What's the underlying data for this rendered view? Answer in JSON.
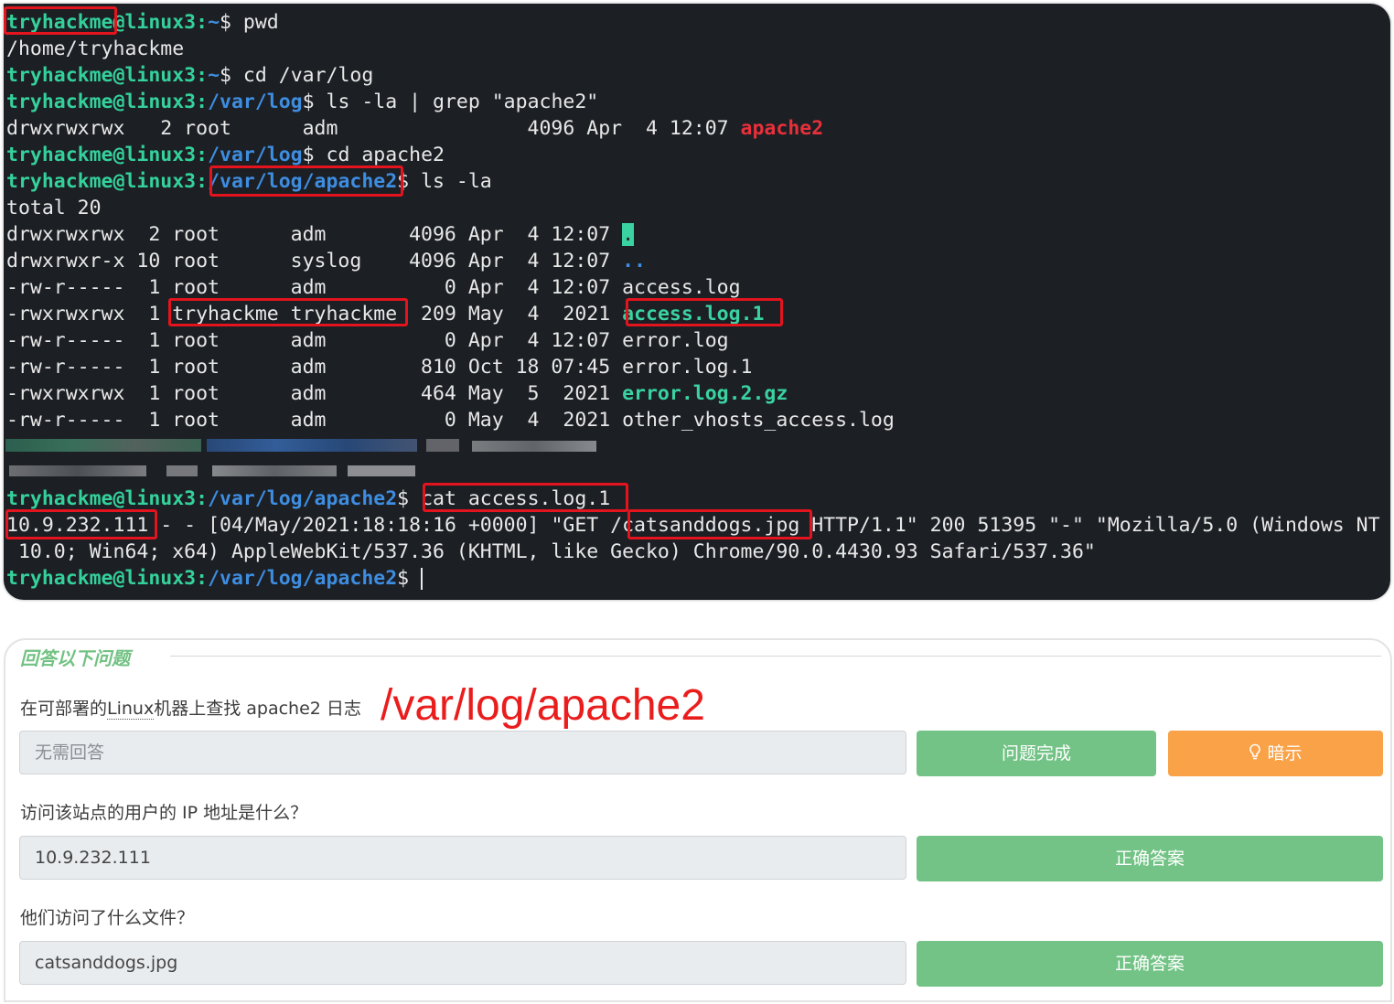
{
  "terminal": {
    "prompt_user": "tryhackme",
    "prompt_at_host": "@linux3:",
    "home": "~",
    "dollar": "$",
    "lines": {
      "l1_cmd": " pwd",
      "l2_out": "/home/tryhackme",
      "l3_cmd": " cd /var/log",
      "l4_path": "/var/log",
      "l4_cmd": " ls -la | grep \"apache2\"",
      "l5_out": "drwxrwxrwx   2 root      adm                4096 Apr  4 12:07 ",
      "l5_dir": "apache2",
      "l6_path": "/var/log",
      "l6_cmd": " cd apache2",
      "l7_path": "/var/log/apache2",
      "l7_cmd": " ls -la",
      "l8_out": "total 20",
      "r1": "drwxrwxrwx  2 root      adm       4096 Apr  4 12:07 ",
      "r1_name": ".",
      "r2": "drwxrwxr-x 10 root      syslog    4096 Apr  4 12:07 ",
      "r2_name": "..",
      "r3": "-rw-r-----  1 root      adm          0 Apr  4 12:07 access.log",
      "r4a": "-rwxrwxrwx  1 ",
      "r4b": "tryhackme tryhackme",
      "r4c": "  209 May  4  2021 ",
      "r4_name": "access.log.1",
      "r5": "-rw-r-----  1 root      adm          0 Apr  4 12:07 error.log",
      "r6": "-rw-r-----  1 root      adm        810 Oct 18 07:45 error.log.1",
      "r7": "-rwxrwxrwx  1 root      adm        464 May  5  2021 ",
      "r7_name": "error.log.2.gz",
      "r8": "-rw-r-----  1 root      adm          0 May  4  2021 other_vhosts_access.log",
      "cat_path": "/var/log/apache2",
      "cat_cmd": "cat access.log.1",
      "log_ip": "10.9.232.111",
      "log_rest": " - - [04/May/2021:18:18:16 +0000] \"GET /",
      "log_file": "catsanddogs.jpg",
      "log_rest2": " HTTP/1.1\" 200 51395 \"-\" \"Mozilla/5.0 (Windows NT",
      "log_line2": " 10.0; Win64; x64) AppleWebKit/537.36 (KHTML, like Gecko) Chrome/90.0.4430.93 Safari/537.36\"",
      "final_path": "/var/log/apache2"
    }
  },
  "panel": {
    "title": "回答以下问题",
    "q1_prefix": "在可部署的",
    "q1_link": "Linux",
    "q1_suffix": "机器上查找 apache2 日志",
    "annotation": "/var/log/apache2",
    "q1_placeholder": "无需回答",
    "q1_done_btn": "问题完成",
    "q1_hint_btn": "暗示",
    "q2_text": "访问该站点的用户的 IP 地址是什么？",
    "q2_answer": "10.9.232.111",
    "q2_btn": "正确答案",
    "q3_text": "他们访问了什么文件？",
    "q3_answer": "catsanddogs.jpg",
    "q3_btn": "正确答案"
  },
  "colors": {
    "terminal_bg": "#1c1f24",
    "prompt_green": "#34d19b",
    "path_blue": "#3e8de0",
    "highlight_red": "#e3141e",
    "button_green": "#72c385",
    "button_orange": "#f9a248"
  },
  "icons": {
    "hint": "lightbulb-icon"
  }
}
